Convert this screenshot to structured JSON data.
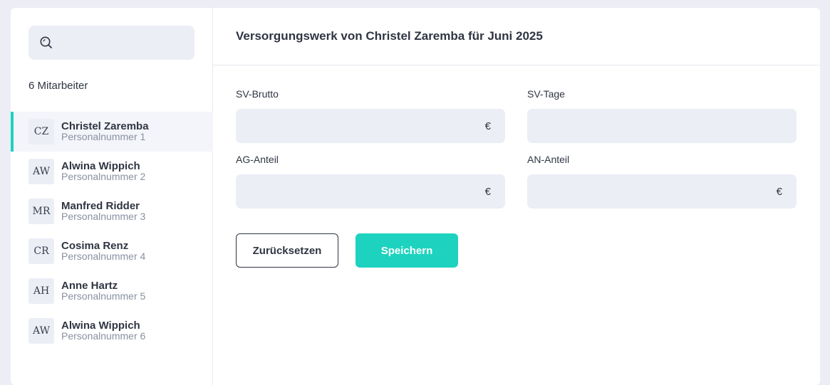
{
  "search": {
    "placeholder": "",
    "icon": "search-icon"
  },
  "employees_count_label": "6 Mitarbeiter",
  "employees": [
    {
      "initials": "CZ",
      "name": "Christel Zaremba",
      "number": "Personalnummer 1",
      "active": true
    },
    {
      "initials": "AW",
      "name": "Alwina Wippich",
      "number": "Personalnummer 2",
      "active": false
    },
    {
      "initials": "MR",
      "name": "Manfred Ridder",
      "number": "Personalnummer 3",
      "active": false
    },
    {
      "initials": "CR",
      "name": "Cosima Renz",
      "number": "Personalnummer 4",
      "active": false
    },
    {
      "initials": "AH",
      "name": "Anne Hartz",
      "number": "Personalnummer 5",
      "active": false
    },
    {
      "initials": "AW",
      "name": "Alwina Wippich",
      "number": "Personalnummer 6",
      "active": false
    }
  ],
  "main": {
    "title": "Versorgungswerk von Christel Zaremba für Juni 2025",
    "fields": {
      "sv_brutto": {
        "label": "SV-Brutto",
        "value": "",
        "unit": "€"
      },
      "sv_tage": {
        "label": "SV-Tage",
        "value": "",
        "unit": ""
      },
      "ag_anteil": {
        "label": "AG-Anteil",
        "value": "",
        "unit": "€"
      },
      "an_anteil": {
        "label": "AN-Anteil",
        "value": "",
        "unit": "€"
      }
    },
    "buttons": {
      "reset": "Zurücksetzen",
      "save": "Speichern"
    }
  },
  "colors": {
    "accent": "#1dd3bf",
    "input_bg": "#eceef6",
    "page_bg": "#ecedf5",
    "text": "#2f3542"
  }
}
